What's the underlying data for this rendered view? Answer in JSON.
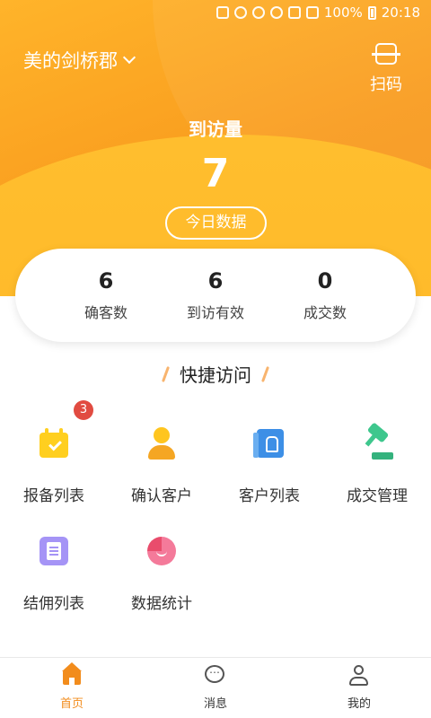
{
  "status_bar": {
    "battery": "100%",
    "time": "20:18"
  },
  "header": {
    "project_name": "美的剑桥郡",
    "scan_label": "扫码"
  },
  "visits": {
    "title": "到访量",
    "value": "7",
    "today_button": "今日数据"
  },
  "stats": [
    {
      "value": "6",
      "label": "确客数"
    },
    {
      "value": "6",
      "label": "到访有效"
    },
    {
      "value": "0",
      "label": "成交数"
    }
  ],
  "quick_access": {
    "title": "快捷访问",
    "items": [
      {
        "label": "报备列表",
        "icon": "calendar-check-icon",
        "badge": "3"
      },
      {
        "label": "确认客户",
        "icon": "person-icon"
      },
      {
        "label": "客户列表",
        "icon": "contact-book-icon"
      },
      {
        "label": "成交管理",
        "icon": "gavel-icon"
      },
      {
        "label": "结佣列表",
        "icon": "document-icon"
      },
      {
        "label": "数据统计",
        "icon": "pie-chart-icon"
      }
    ]
  },
  "tabbar": {
    "items": [
      {
        "label": "首页",
        "icon": "home-icon",
        "active": true
      },
      {
        "label": "消息",
        "icon": "chat-icon",
        "active": false
      },
      {
        "label": "我的",
        "icon": "profile-icon",
        "active": false
      }
    ],
    "active_color": "#f28c1c"
  },
  "colors": {
    "brand_orange": "#f99c1e",
    "badge_red": "#e14b41"
  }
}
